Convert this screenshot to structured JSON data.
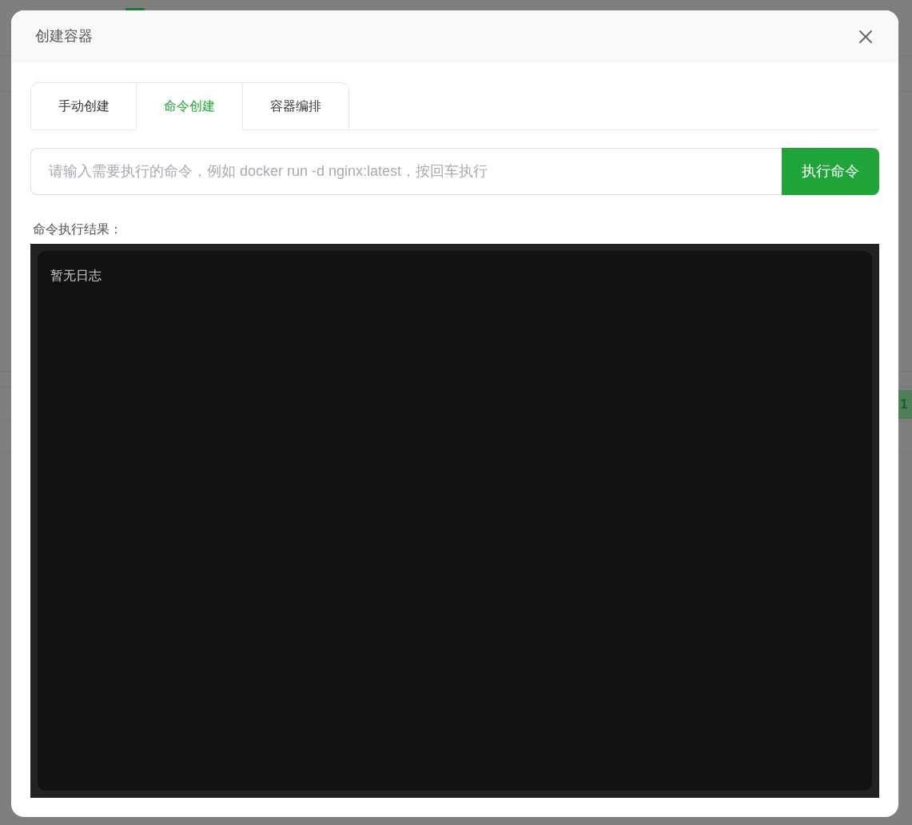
{
  "background": {
    "badge": "1"
  },
  "dialog": {
    "title": "创建容器",
    "tabs": [
      {
        "label": "手动创建",
        "selected": false
      },
      {
        "label": "命令创建",
        "selected": true
      },
      {
        "label": "容器编排",
        "selected": false
      }
    ],
    "command_field": {
      "placeholder": "请输入需要执行的命令，例如 docker run -d nginx:latest，按回车执行"
    },
    "run_button": "执行命令",
    "output_label": "命令执行结果：",
    "output_log": "暂无日志"
  }
}
